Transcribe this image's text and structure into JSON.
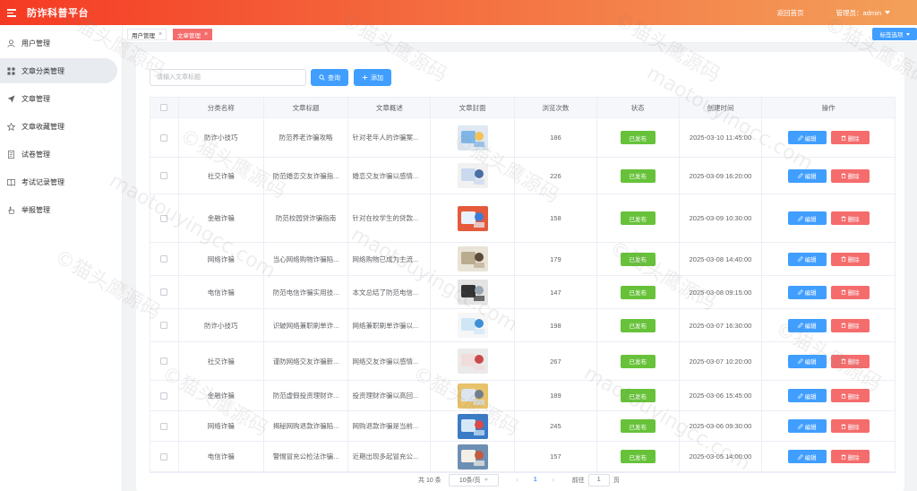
{
  "header": {
    "app_title": "防诈科普平台",
    "home_link": "返回首页",
    "admin_label": "管理员：admin"
  },
  "sidebar": {
    "items": [
      {
        "label": "用户管理",
        "icon": "user-icon"
      },
      {
        "label": "文章分类管理",
        "icon": "grid-icon"
      },
      {
        "label": "文章管理",
        "icon": "send-icon"
      },
      {
        "label": "文章收藏管理",
        "icon": "star-icon"
      },
      {
        "label": "试卷管理",
        "icon": "document-icon"
      },
      {
        "label": "考试记录管理",
        "icon": "book-icon"
      },
      {
        "label": "举报管理",
        "icon": "hand-icon"
      }
    ],
    "active_index": 1
  },
  "tabs": {
    "items": [
      {
        "label": "用户管理",
        "active": false
      },
      {
        "label": "文章管理",
        "active": true
      }
    ],
    "options_label": "标签选项"
  },
  "toolbar": {
    "search_placeholder": "请输入文章标题",
    "query_label": "查询",
    "add_label": "添加"
  },
  "table": {
    "headers": [
      "分类名称",
      "文章标题",
      "文章概述",
      "文章封面",
      "浏览次数",
      "状态",
      "创建时间",
      "操作"
    ],
    "rows": [
      {
        "category": "防诈小技巧",
        "title": "防范养老诈骗攻略",
        "summary": "针对老年人的诈骗案...",
        "views": "186",
        "status": "已发布",
        "created": "2025-03-10 11:45:00"
      },
      {
        "category": "社交诈骗",
        "title": "防范婚恋交友诈骗指...",
        "summary": "婚恋交友诈骗以感情...",
        "views": "226",
        "status": "已发布",
        "created": "2025-03-09 16:20:00"
      },
      {
        "category": "金融诈骗",
        "title": "防范校园贷诈骗指南",
        "summary": "针对在校学生的贷款...",
        "views": "158",
        "status": "已发布",
        "created": "2025-03-09 10:30:00"
      },
      {
        "category": "网络诈骗",
        "title": "当心网络购物诈骗陷...",
        "summary": "网络购物已成为主流...",
        "views": "179",
        "status": "已发布",
        "created": "2025-03-08 14:40:00"
      },
      {
        "category": "电信诈骗",
        "title": "防范电信诈骗实用技...",
        "summary": "本文总结了防范电信...",
        "views": "147",
        "status": "已发布",
        "created": "2025-03-08 09:15:00"
      },
      {
        "category": "防诈小技巧",
        "title": "识破网络兼职刷单诈...",
        "summary": "网络兼职刷单诈骗以...",
        "views": "198",
        "status": "已发布",
        "created": "2025-03-07 16:30:00"
      },
      {
        "category": "社交诈骗",
        "title": "谨防网络交友诈骗新...",
        "summary": "网络交友诈骗以感情...",
        "views": "267",
        "status": "已发布",
        "created": "2025-03-07 10:20:00"
      },
      {
        "category": "金融诈骗",
        "title": "防范虚假投资理财诈...",
        "summary": "投资理财诈骗以高回...",
        "views": "189",
        "status": "已发布",
        "created": "2025-03-06 15:45:00"
      },
      {
        "category": "网络诈骗",
        "title": "揭秘网购退款诈骗陷...",
        "summary": "网购退款诈骗是当前...",
        "views": "245",
        "status": "已发布",
        "created": "2025-03-06 09:30:00"
      },
      {
        "category": "电信诈骗",
        "title": "警惕冒充公检法诈骗...",
        "summary": "近期出现多起冒充公...",
        "views": "157",
        "status": "已发布",
        "created": "2025-03-05 14:00:00"
      }
    ],
    "edit_label": "编辑",
    "delete_label": "删除"
  },
  "pagination": {
    "total": "共 10 条",
    "page_size": "10条/页",
    "current_page": "1",
    "goto_label": "前往",
    "goto_value": "1",
    "page_suffix": "页"
  },
  "watermark": {
    "text1": "©猫头鹰源码",
    "text2": "maotouyingcc.com"
  }
}
